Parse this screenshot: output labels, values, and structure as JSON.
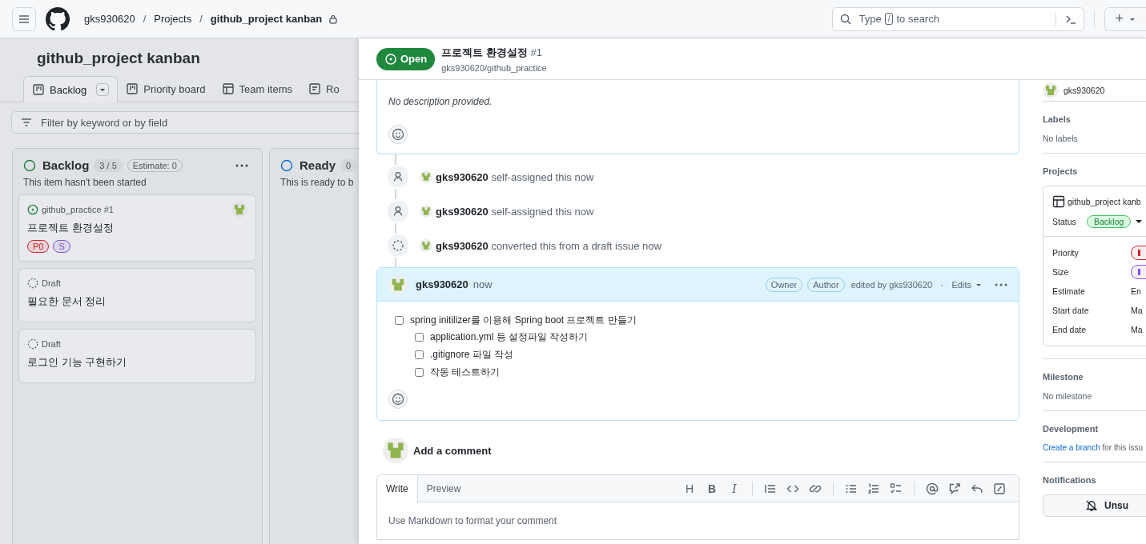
{
  "header": {
    "owner": "gks930620",
    "separators": [
      "/",
      "/"
    ],
    "section": "Projects",
    "project": "github_project kanban",
    "search": {
      "before": "Type",
      "key": "/",
      "after": "to search"
    },
    "new": "+"
  },
  "project": {
    "title": "github_project kanban",
    "views": [
      {
        "label": "Backlog",
        "kind": "board",
        "selected": true
      },
      {
        "label": "Priority board",
        "kind": "board",
        "selected": false
      },
      {
        "label": "Team items",
        "kind": "table",
        "selected": false
      },
      {
        "label": "Ro",
        "kind": "roadmap",
        "selected": false
      }
    ],
    "filter": {
      "placeholder": "Filter by keyword or by field"
    },
    "columns": [
      {
        "name": "Backlog",
        "color": "#1a7f37",
        "count": "3 / 5",
        "estimate": "Estimate: 0",
        "description": "This item hasn't been started",
        "cards": [
          {
            "kind": "issue",
            "ref": "github_practice #1",
            "title": "프로젝트 환경설정",
            "assigned": true,
            "labels": [
              {
                "text": "P0",
                "color": "#d1242f"
              },
              {
                "text": "S",
                "color": "#8250df"
              }
            ]
          },
          {
            "kind": "draft",
            "ref": "Draft",
            "title": "필요한 문서 정리",
            "assigned": false
          },
          {
            "kind": "draft",
            "ref": "Draft",
            "title": "로그인 기능 구현하기",
            "assigned": false
          }
        ]
      },
      {
        "name": "Ready",
        "color": "#0969da",
        "count": "0",
        "description": "This is ready to b"
      }
    ]
  },
  "issue": {
    "state": "Open",
    "title": "프로젝트 환경설정",
    "number": "#1",
    "repo": "gks930620/github_practice",
    "description": "No description provided.",
    "events": [
      {
        "kind": "assigned",
        "user": "gks930620",
        "text": "self-assigned this now"
      },
      {
        "kind": "assigned",
        "user": "gks930620",
        "text": "self-assigned this now"
      },
      {
        "kind": "converted",
        "user": "gks930620",
        "text": "converted this from a draft issue now"
      }
    ],
    "comment": {
      "user": "gks930620",
      "time": "now",
      "badges": [
        "Owner",
        "Author"
      ],
      "edited": "edited by gks930620",
      "separator": "·",
      "edits": "Edits",
      "tasks": [
        {
          "text": "spring initilizer를 이용해 Spring boot 프로젝트 만들기",
          "checked": false,
          "children": [
            {
              "text": "application.yml 등 설정파일 작성하기",
              "checked": false
            },
            {
              "text": ".gitignore 파일 작성",
              "checked": false
            },
            {
              "text": "작동 테스트하기",
              "checked": false
            }
          ]
        }
      ]
    },
    "composer": {
      "heading": "Add a comment",
      "tabs": [
        {
          "label": "Write",
          "selected": true
        },
        {
          "label": "Preview",
          "selected": false
        }
      ],
      "toolbar": [
        {
          "kind": "heading",
          "label": "H"
        },
        {
          "kind": "bold",
          "label": "B"
        },
        {
          "kind": "italic",
          "label": "I"
        },
        {
          "kind": "sep"
        },
        {
          "kind": "quote"
        },
        {
          "kind": "code"
        },
        {
          "kind": "link"
        },
        {
          "kind": "sep"
        },
        {
          "kind": "bullets"
        },
        {
          "kind": "numbers"
        },
        {
          "kind": "tasks"
        },
        {
          "kind": "sep"
        },
        {
          "kind": "mention"
        },
        {
          "kind": "reference"
        },
        {
          "kind": "reply"
        },
        {
          "kind": "slash"
        }
      ],
      "placeholder": "Use Markdown to format your comment"
    }
  },
  "sidebar": {
    "assignee": "gks930620",
    "labels": {
      "title": "Labels",
      "value": "No labels"
    },
    "projects": {
      "title": "Projects",
      "name": "github_project kanb",
      "status_label": "Status",
      "status": "Backlog",
      "fields": [
        {
          "name": "Priority",
          "kind": "pill",
          "color": "#d1242f"
        },
        {
          "name": "Size",
          "kind": "pill",
          "color": "#8250df"
        },
        {
          "name": "Estimate",
          "kind": "text",
          "value": "En"
        },
        {
          "name": "Start date",
          "kind": "text",
          "value": "Ma"
        },
        {
          "name": "End date",
          "kind": "text",
          "value": "Ma"
        }
      ]
    },
    "milestone": {
      "title": "Milestone",
      "value": "No milestone"
    },
    "development": {
      "title": "Development",
      "link": "Create a branch",
      "rest": "for this issu"
    },
    "notifications": {
      "title": "Notifications",
      "button": "Unsu"
    }
  }
}
